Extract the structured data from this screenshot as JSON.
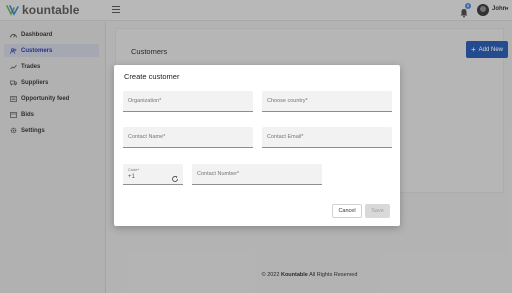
{
  "brand": {
    "name": "kountable"
  },
  "header": {
    "notifications_count": "5",
    "user_name": "John",
    "user_caret": "▾"
  },
  "sidebar": {
    "items": [
      {
        "label": "Dashboard",
        "icon": "dashboard-icon",
        "active": false
      },
      {
        "label": "Customers",
        "icon": "users-icon",
        "active": true
      },
      {
        "label": "Trades",
        "icon": "chart-line-icon",
        "active": false
      },
      {
        "label": "Suppliers",
        "icon": "truck-icon",
        "active": false
      },
      {
        "label": "Opportunity feed",
        "icon": "feed-icon",
        "active": false
      },
      {
        "label": "Bids",
        "icon": "list-icon",
        "active": false
      },
      {
        "label": "Settings",
        "icon": "gear-icon",
        "active": false
      }
    ]
  },
  "main": {
    "title": "Customers",
    "add_button": {
      "plus": "+",
      "label": "Add New"
    }
  },
  "footer": {
    "prefix": "© 2022",
    "brand": "Kountable",
    "suffix": "All Rights Reserved"
  },
  "modal": {
    "title": "Create customer",
    "fields": {
      "organization": {
        "placeholder": "Organization*"
      },
      "country": {
        "placeholder": "Choose country*"
      },
      "contact_name": {
        "placeholder": "Contact Name*"
      },
      "contact_email": {
        "placeholder": "Contact Email*"
      },
      "code": {
        "label": "Code*",
        "value": "+1"
      },
      "contact_number": {
        "placeholder": "Contact Number*"
      }
    },
    "cancel_label": "Cancel",
    "save_label": "Save"
  },
  "colors": {
    "accent": "#2c5aa8",
    "active_nav_text": "#2b3d9c",
    "badge": "#4a7fd0"
  }
}
